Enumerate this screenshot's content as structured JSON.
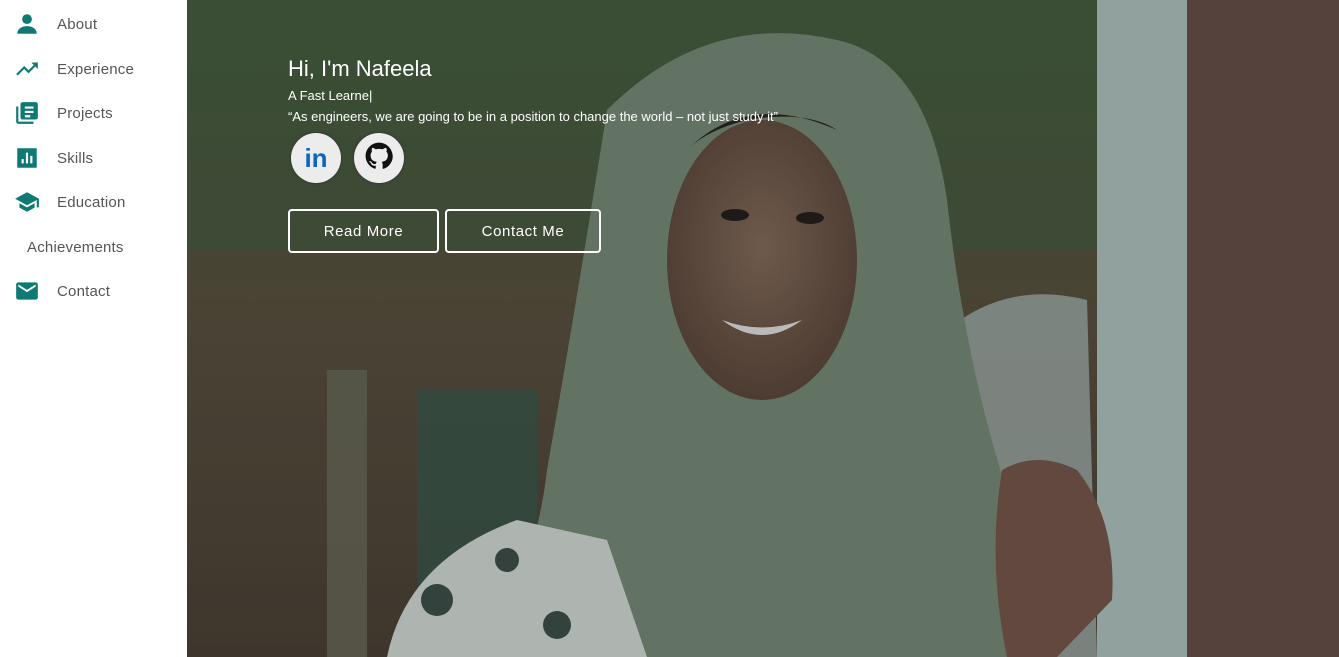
{
  "sidebar": {
    "items": [
      {
        "label": "About",
        "icon": "person-icon"
      },
      {
        "label": "Experience",
        "icon": "trending-up-icon"
      },
      {
        "label": "Projects",
        "icon": "article-icon"
      },
      {
        "label": "Skills",
        "icon": "bar-chart-icon"
      },
      {
        "label": "Education",
        "icon": "school-icon"
      },
      {
        "label": "Achievements",
        "icon": ""
      },
      {
        "label": "Contact",
        "icon": "mail-icon"
      }
    ]
  },
  "hero": {
    "greeting": "Hi, I'm Nafeela",
    "tagline": "A Fast Learne|",
    "quote": "“As engineers, we are going to be in a position to change the world – not just study it”",
    "socials": [
      {
        "label": "in",
        "icon": "linkedin-icon"
      },
      {
        "icon": "github-icon"
      }
    ],
    "buttons": {
      "read_more": "Read More",
      "contact_me": "Contact Me"
    }
  },
  "colors": {
    "accent": "#0f7a73",
    "linkedin": "#0a66c2"
  }
}
